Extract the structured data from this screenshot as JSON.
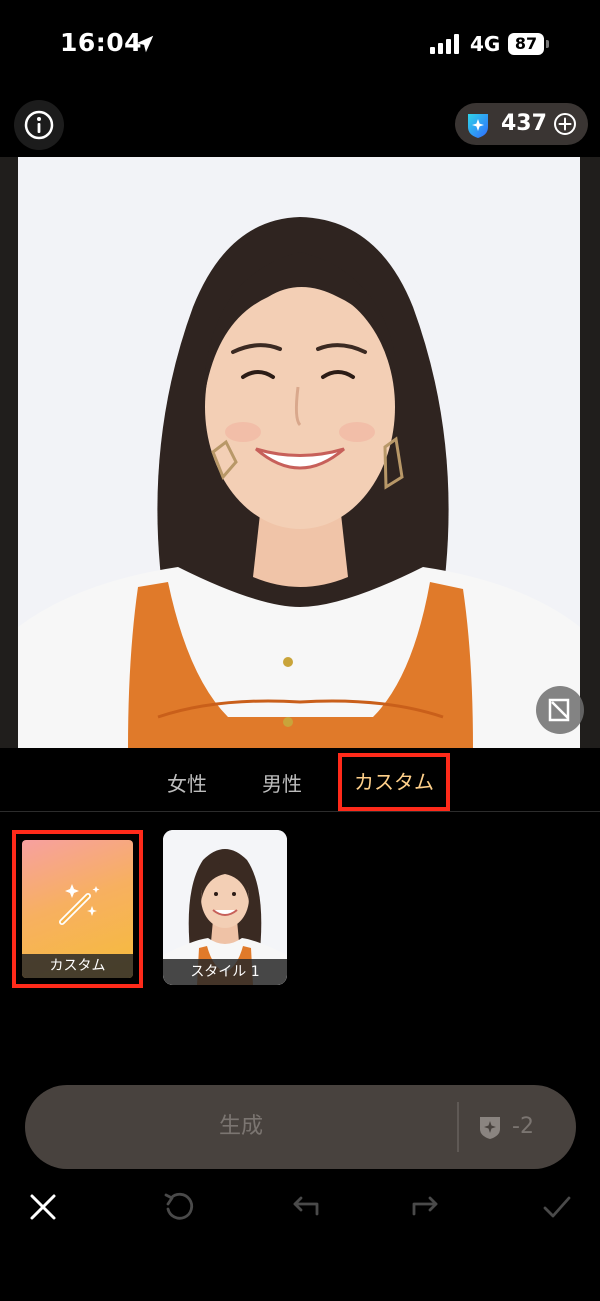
{
  "status_bar": {
    "time": "16:04",
    "network": "4G",
    "battery": "87"
  },
  "header": {
    "credits": "437",
    "icons": {
      "info": "info-icon",
      "gem": "gem-icon",
      "add": "plus-circle-icon"
    }
  },
  "photo": {
    "description_icon": "compare-icon"
  },
  "tabs": [
    {
      "label": "女性"
    },
    {
      "label": "男性"
    },
    {
      "label": "カスタム",
      "selected": true
    }
  ],
  "styles": [
    {
      "label": "カスタム",
      "icon": "magic-wand-icon",
      "selected": true
    },
    {
      "label": "スタイル 1"
    }
  ],
  "generate": {
    "label": "生成",
    "cost": "-2"
  },
  "toolbar": {
    "icons": [
      "close-icon",
      "reset-icon",
      "undo-icon",
      "redo-icon",
      "check-icon"
    ]
  },
  "colors": {
    "accent_highlight": "#ff2a1a",
    "selected_tab_text": "#ffd08a",
    "gem_blue": "#2f8cff",
    "generate_bg": "#48423e"
  }
}
